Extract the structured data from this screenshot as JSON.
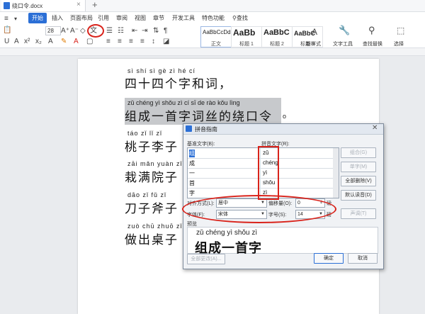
{
  "doc_tab": {
    "title": "绕口令.docx"
  },
  "menu": {
    "items": [
      "开始",
      "插入",
      "页面布局",
      "引用",
      "审阅",
      "视图",
      "章节",
      "开发工具",
      "特色功能"
    ],
    "search": "查找"
  },
  "toolbar": {
    "font_size": "28",
    "styles": [
      {
        "preview": "AaBbCcDd",
        "label": "正文"
      },
      {
        "preview": "AaBb",
        "label": "标题 1"
      },
      {
        "preview": "AaBbC",
        "label": "标题 2"
      },
      {
        "preview": "AaBbC",
        "label": "标题 3"
      }
    ],
    "new_style": "新样式",
    "text_tools": "文字工具",
    "find_replace": "查找替换",
    "select": "选择"
  },
  "document": {
    "lines": [
      {
        "pinyin": "sì  shí  sì  gè  zì  hé  cí",
        "hanzi": "四十四个字和词，"
      },
      {
        "pinyin": "zǔ chéng yì  shǒu zì  cí   sī   de  rào kǒu lìng",
        "hanzi": "组成一首字词丝的绕口令"
      },
      {
        "pinyin": "táo  zǐ   lǐ   zǐ",
        "hanzi": "桃子李子"
      },
      {
        "pinyin": "zāi mǎn yuàn zǐ",
        "hanzi": "栽满院子"
      },
      {
        "pinyin": "dāo  zǐ   fǔ  zǐ",
        "hanzi": "刀子斧子"
      },
      {
        "pinyin": "zuò chū zhuō zǐ",
        "hanzi": "做出桌子"
      }
    ],
    "trailing_mark": "o"
  },
  "dialog": {
    "title": "拼音指南",
    "base_text_label": "基准文字(B):",
    "pinyin_text_label": "拼音文字(R):",
    "rows": [
      {
        "base": "组",
        "pinyin": "zǔ"
      },
      {
        "base": "成",
        "pinyin": "chéng"
      },
      {
        "base": "一",
        "pinyin": "yì"
      },
      {
        "base": "首",
        "pinyin": "shǒu"
      },
      {
        "base": "字",
        "pinyin": "zì"
      }
    ],
    "buttons": {
      "combine": "组合(G)",
      "single": "单字(M)",
      "clear_all": "全部删除(V)",
      "default_reading": "默认读音(D)",
      "tone": "声调(T)",
      "ok": "确定",
      "cancel": "取消",
      "all_change": "全部更改(A)..."
    },
    "align_label": "对齐方式(L):",
    "align_value": "居中",
    "offset_label": "偏移量(O):",
    "offset_value": "0",
    "offset_unit": "磅",
    "font_label": "字体(F):",
    "font_value": "宋体",
    "size_label": "字号(S):",
    "size_value": "14",
    "size_unit": "磅",
    "preview_label": "预览",
    "preview_pinyin": "zǔ chéng yì  shǒu zì",
    "preview_hanzi": "组成一首字"
  },
  "colors": {
    "accent": "#2b6fd6",
    "annotation": "#d9231b",
    "selection": "#c7c9cc"
  }
}
